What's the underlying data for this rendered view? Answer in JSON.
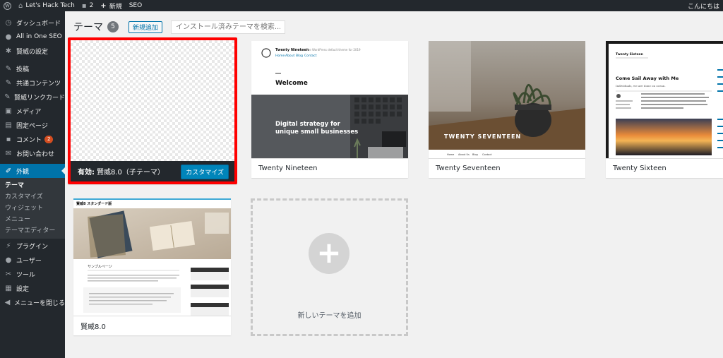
{
  "adminbar": {
    "site_name": "Let's Hack Tech",
    "comments_count": "2",
    "new_label": "新規",
    "seo_label": "SEO",
    "greeting": "こんにちは"
  },
  "sidebar": {
    "items": [
      {
        "label": "ダッシュボード"
      },
      {
        "label": "All in One SEO"
      },
      {
        "label": "賢威の設定"
      },
      {
        "label": "投稿"
      },
      {
        "label": "共通コンテンツ"
      },
      {
        "label": "賢威リンクカード"
      },
      {
        "label": "メディア"
      },
      {
        "label": "固定ページ"
      },
      {
        "label": "コメント",
        "badge": "2"
      },
      {
        "label": "お問い合わせ"
      },
      {
        "label": "外観"
      },
      {
        "label": "プラグイン"
      },
      {
        "label": "ユーザー"
      },
      {
        "label": "ツール"
      },
      {
        "label": "設定"
      },
      {
        "label": "メニューを閉じる"
      }
    ],
    "submenu": [
      {
        "label": "テーマ"
      },
      {
        "label": "カスタマイズ"
      },
      {
        "label": "ウィジェット"
      },
      {
        "label": "メニュー"
      },
      {
        "label": "テーマエディター"
      }
    ]
  },
  "header": {
    "title": "テーマ",
    "count": "5",
    "add_new": "新規追加",
    "search_placeholder": "インストール済みテーマを検索..."
  },
  "themes": {
    "active": {
      "label": "有効:",
      "name": "賢威8.0（子テーマ）",
      "customize": "カスタマイズ"
    },
    "nineteen": {
      "name": "Twenty Nineteen",
      "shot_site": "Twenty Nineteen",
      "shot_tagline": "— The WordPress default theme for 2019",
      "shot_nav": [
        "Home",
        "About",
        "Blog",
        "Contact"
      ],
      "shot_welcome": "Welcome",
      "shot_headline_1": "Digital strategy for",
      "shot_headline_2": "unique small businesses"
    },
    "seventeen": {
      "name": "Twenty Seventeen",
      "shot_title": "TWENTY SEVENTEEN",
      "shot_nav": [
        "Home",
        "About Us",
        "Blog",
        "Contact"
      ]
    },
    "sixteen": {
      "name": "Twenty Sixteen",
      "shot_site": "Twenty Sixteen",
      "shot_heading": "Come Sail Away with Me",
      "shot_intro": "Individuals, we are done on ocean."
    },
    "kenei": {
      "name": "賢威8.0",
      "shot_site": "賢威8 スタンダード版",
      "shot_page": "サンプルページ"
    }
  },
  "add_new_card": {
    "label": "新しいテーマを追加",
    "plus": "+"
  },
  "colors": {
    "accent": "#0073aa",
    "active_border": "#ff0000",
    "sidebar": "#23282d"
  }
}
